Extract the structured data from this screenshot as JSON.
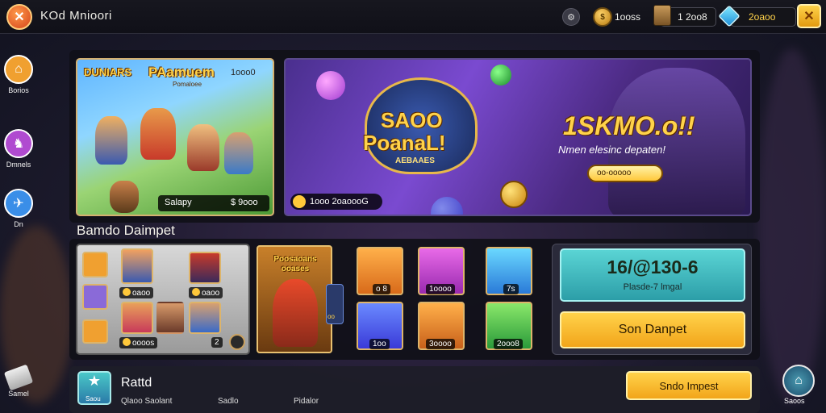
{
  "topbar": {
    "title": "KOd Mnioori",
    "settings_icon": "gear-icon",
    "coins": "1ooss",
    "chest_amount": "1  2oo8",
    "gems": "2oaoo",
    "shop_icon": "shop-icon"
  },
  "sidebar": {
    "items": [
      {
        "label": "Borios",
        "icon": "home-icon",
        "color": "#f0a030"
      },
      {
        "label": "Dmnels",
        "icon": "hero-icon",
        "color": "#b04ad0"
      },
      {
        "label": "Dn",
        "icon": "bird-icon",
        "color": "#3a8ee8"
      }
    ],
    "bottom_label": "Samel"
  },
  "card_left": {
    "tag": "DUNIARS",
    "title": "PAamuem",
    "subtitle": "Pomaloee",
    "price_top": "1ooo0",
    "footer_label": "Salapy",
    "footer_value": "$ 9ooo"
  },
  "card_main": {
    "logo_line1": "SAOO",
    "logo_line2": "PoanaL!",
    "logo_sub": "AEBAAES",
    "headline": "1SKMO.o!!",
    "subline": "Nmen elesinc depaten!",
    "button_text": "oo-ooooo",
    "footer_text": "1ooo 2oaoooG"
  },
  "section": {
    "title": "Bamdo Daimpet"
  },
  "grid_left": {
    "labels": [
      "oaoo",
      "oaoo",
      "oooos"
    ],
    "count": "2"
  },
  "featured": {
    "title": "Poosaoans ooases",
    "side_num": "oo"
  },
  "items": [
    {
      "label": "o 8",
      "bg": "#d88a2a"
    },
    {
      "label": "1oooo",
      "bg": "#c83aa8"
    },
    {
      "label": "7s",
      "bg": "#3a9ad8"
    },
    {
      "label": "1oo",
      "bg": "#3a6ad8"
    },
    {
      "label": "3oooo",
      "bg": "#d87a2a"
    },
    {
      "label": "2ooo8",
      "bg": "#3aa84a"
    }
  ],
  "offer": {
    "amount": "16/@130-6",
    "sub": "Plasde-7 lmgal",
    "button": "Son Danpet"
  },
  "bottom": {
    "title": "Rattd",
    "icon_label": "Saou",
    "cols": [
      "Qlaoo Saolant",
      "Sadlo",
      "Pidalor"
    ],
    "button": "Sndo Impest",
    "right_label": "Saoos"
  }
}
